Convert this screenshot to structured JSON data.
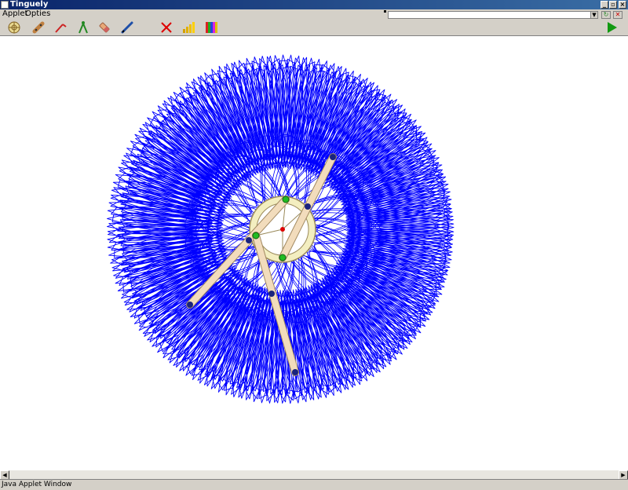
{
  "window": {
    "title": "Tinguely"
  },
  "menu": {
    "items": [
      "Applet",
      "Opties"
    ]
  },
  "toolbar": {
    "tools": [
      "wheel-icon",
      "arm-icon",
      "hinge-icon",
      "compass-icon",
      "eraser-icon",
      "pen-icon",
      "delete-icon",
      "bar-chart-icon",
      "color-palette-icon"
    ],
    "run": "play-icon"
  },
  "status": {
    "text": "Java Applet Window"
  },
  "colors": {
    "pattern": "#0000ff",
    "arm": "#f2dcbc",
    "wheel": "#f3eec0",
    "joint_green": "#22bb22",
    "joint_navy": "#1a237e",
    "center": "#dd0000"
  }
}
